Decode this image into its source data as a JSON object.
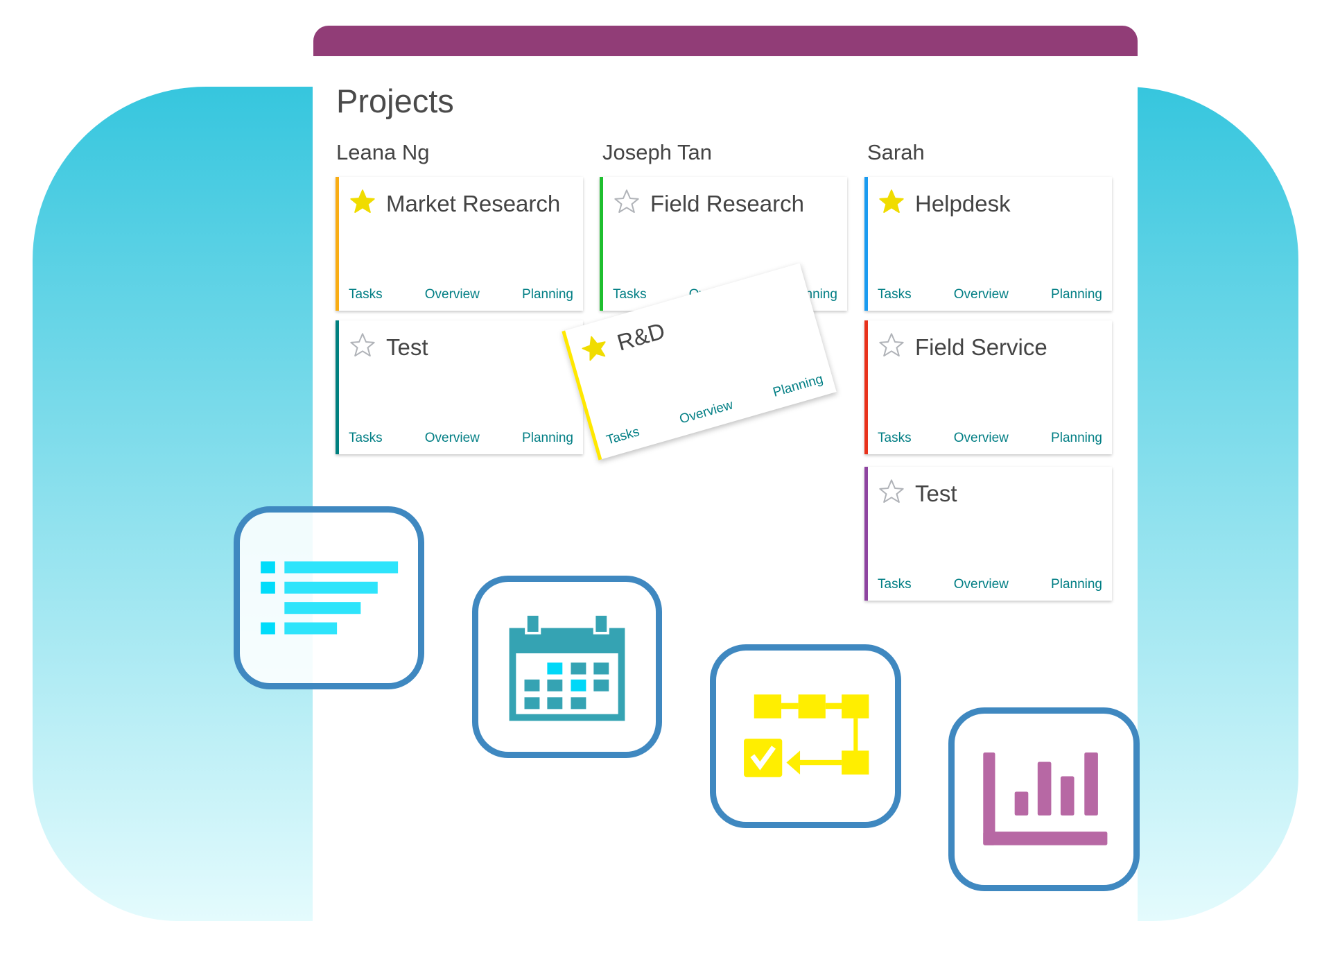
{
  "header": {
    "title": "Projects",
    "accent_color": "#913d77"
  },
  "columns": [
    {
      "owner": "Leana Ng"
    },
    {
      "owner": "Joseph Tan"
    },
    {
      "owner": "Sarah"
    }
  ],
  "cards": [
    {
      "name": "Market Research",
      "starred": true,
      "color": "#f9ad14",
      "links": [
        "Tasks",
        "Overview",
        "Planning"
      ]
    },
    {
      "name": "Test",
      "starred": false,
      "color": "#00807f",
      "links": [
        "Tasks",
        "Overview",
        "Planning"
      ]
    },
    {
      "name": "Field Research",
      "starred": false,
      "color": "#1fbf2f",
      "links": [
        "Tasks",
        "Overview",
        "Planning"
      ]
    },
    {
      "name": "Helpdesk",
      "starred": true,
      "color": "#1a9bf0",
      "links": [
        "Tasks",
        "Overview",
        "Planning"
      ]
    },
    {
      "name": "Field Service",
      "starred": false,
      "color": "#e8321c",
      "links": [
        "Tasks",
        "Overview",
        "Planning"
      ]
    },
    {
      "name": "Test",
      "starred": false,
      "color": "#8e44a0",
      "links": [
        "Tasks",
        "Overview",
        "Planning"
      ]
    },
    {
      "name": "R&D",
      "starred": true,
      "color": "#ffe800",
      "links": [
        "Tasks",
        "Overview",
        "Planning"
      ],
      "dragging": true
    }
  ],
  "feature_icons": [
    "list-icon",
    "calendar-icon",
    "workflow-icon",
    "bar-chart-icon"
  ]
}
